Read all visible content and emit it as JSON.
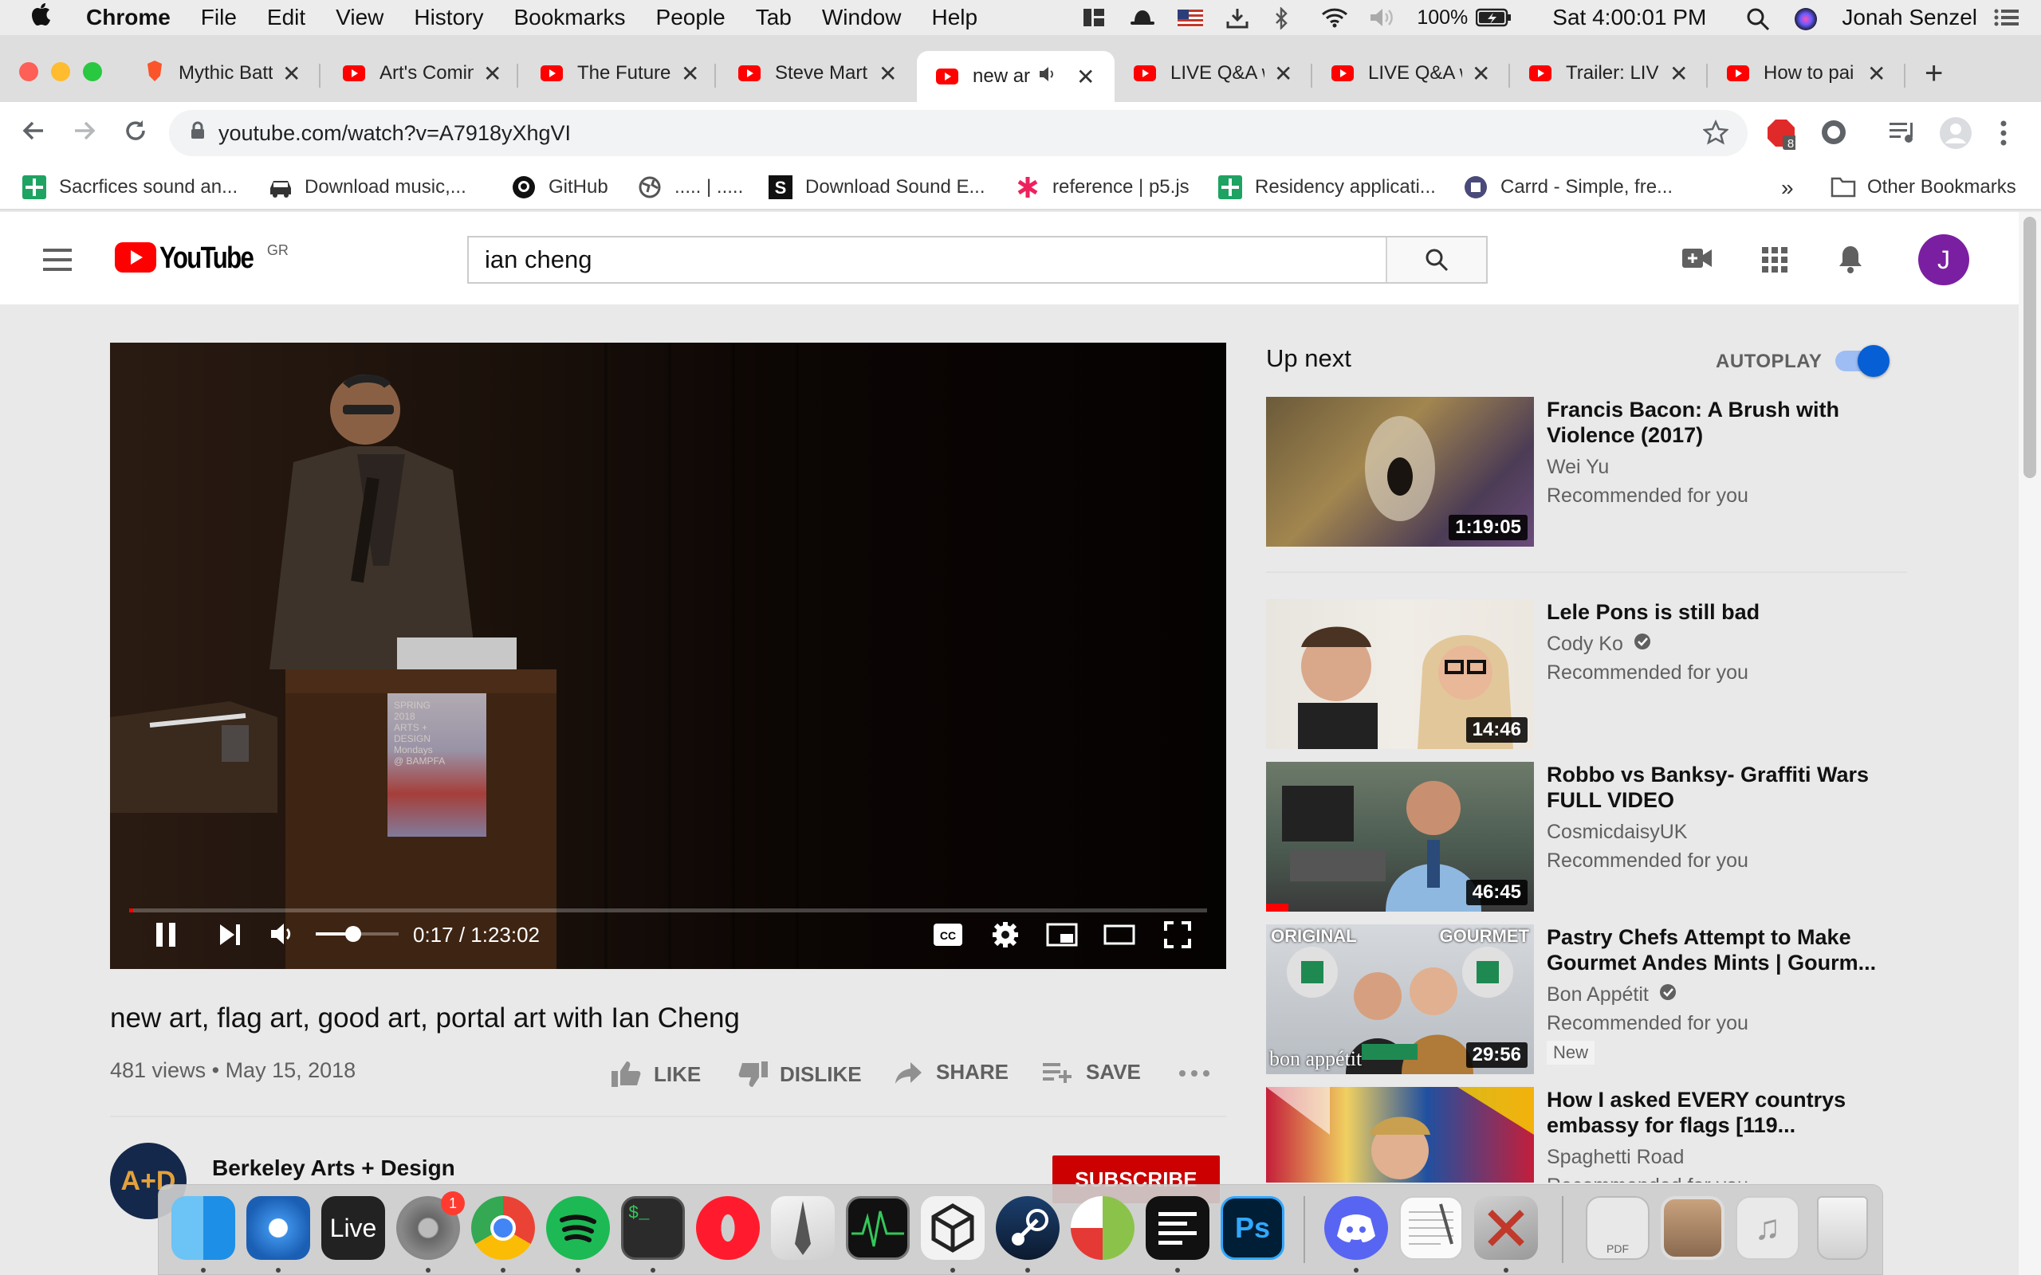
{
  "menubar": {
    "app_name": "Chrome",
    "menus": [
      "File",
      "Edit",
      "View",
      "History",
      "Bookmarks",
      "People",
      "Tab",
      "Window",
      "Help"
    ],
    "battery": "100%",
    "clock": "Sat 4:00:01 PM",
    "user": "Jonah Senzel"
  },
  "tabs": [
    {
      "title": "Mythic Batt",
      "favicon": "brave-icon"
    },
    {
      "title": "Art's Comin",
      "favicon": "youtube-icon"
    },
    {
      "title": "The Future",
      "favicon": "youtube-icon"
    },
    {
      "title": "Steve Mart",
      "favicon": "youtube-icon"
    },
    {
      "title": "new ar",
      "favicon": "youtube-icon",
      "active": true
    },
    {
      "title": "LIVE Q&A w",
      "favicon": "youtube-icon"
    },
    {
      "title": "LIVE Q&A w",
      "favicon": "youtube-icon"
    },
    {
      "title": "Trailer: LIVE",
      "favicon": "youtube-icon"
    },
    {
      "title": "How to pai",
      "favicon": "youtube-icon"
    }
  ],
  "address": {
    "url": "youtube.com/watch?v=A7918yXhgVI",
    "extension_badge": "8"
  },
  "bookmarks": [
    {
      "label": "Sacrfices sound an..."
    },
    {
      "label": "Download music,..."
    },
    {
      "label": "GitHub"
    },
    {
      "label": "..... | ....."
    },
    {
      "label": "Download Sound E..."
    },
    {
      "label": "reference | p5.js"
    },
    {
      "label": "Residency applicati..."
    },
    {
      "label": "Carrd - Simple, fre..."
    }
  ],
  "bookmarks_overflow": "»",
  "other_bookmarks": "Other Bookmarks",
  "youtube": {
    "logo_text": "YouTube",
    "region": "GR",
    "search_query": "ian cheng",
    "avatar_letter": "J"
  },
  "player": {
    "time": "0:17 / 1:23:02",
    "progress_fraction": 0.0034,
    "volume_fraction": 0.45,
    "poster_lines": [
      "SPRING",
      "ARTS +",
      "DESIGN",
      "Mondays",
      "@ BAMPFA"
    ],
    "poster_year": "2018"
  },
  "video": {
    "title": "new art, flag art, good art, portal art with Ian Cheng",
    "views": "481 views",
    "date": "May 15, 2018",
    "like_label": "LIKE",
    "dislike_label": "DISLIKE",
    "share_label": "SHARE",
    "save_label": "SAVE"
  },
  "channel": {
    "name": "Berkeley Arts + Design",
    "avatar_text": "A+D",
    "subscribe_label": "SUBSCRIBE"
  },
  "sidebar": {
    "up_next": "Up next",
    "autoplay": "AUTOPLAY",
    "autoplay_on": true,
    "items": [
      {
        "title": "Francis Bacon: A Brush with Violence (2017)",
        "channel": "Wei Yu",
        "verified": false,
        "subtitle": "Recommended for you",
        "duration": "1:19:05"
      },
      {
        "title": "Lele Pons is still bad",
        "channel": "Cody Ko",
        "verified": true,
        "subtitle": "Recommended for you",
        "duration": "14:46"
      },
      {
        "title": "Robbo vs Banksy- Graffiti Wars FULL VIDEO",
        "channel": "CosmicdaisyUK",
        "verified": false,
        "subtitle": "Recommended for you",
        "duration": "46:45"
      },
      {
        "title": "Pastry Chefs Attempt to Make Gourmet Andes Mints | Gourm...",
        "channel": "Bon Appétit",
        "verified": true,
        "subtitle": "Recommended for you",
        "badge": "New",
        "duration": "29:56",
        "thumb_text_left": "ORIGINAL",
        "thumb_text_right": "GOURMET",
        "thumb_brand": "bon appétit"
      },
      {
        "title": "How I asked EVERY countrys embassy for flags [119...",
        "channel": "Spaghetti Road",
        "verified": false,
        "subtitle": "Recommended for you"
      }
    ]
  },
  "dock": {
    "apps": [
      "finder",
      "safari",
      "ableton-live",
      "system-preferences",
      "chrome",
      "spotify",
      "terminal",
      "opera",
      "pages",
      "activity-monitor",
      "unity",
      "steam",
      "scrivener",
      "stickies",
      "photoshop",
      "discord",
      "textedit",
      "script-editor",
      "preview",
      "photo-booth",
      "music",
      "trash"
    ],
    "live_label": "Live",
    "ps_label": "Ps",
    "notification_badge": "1",
    "pdf_label": "PDF"
  }
}
